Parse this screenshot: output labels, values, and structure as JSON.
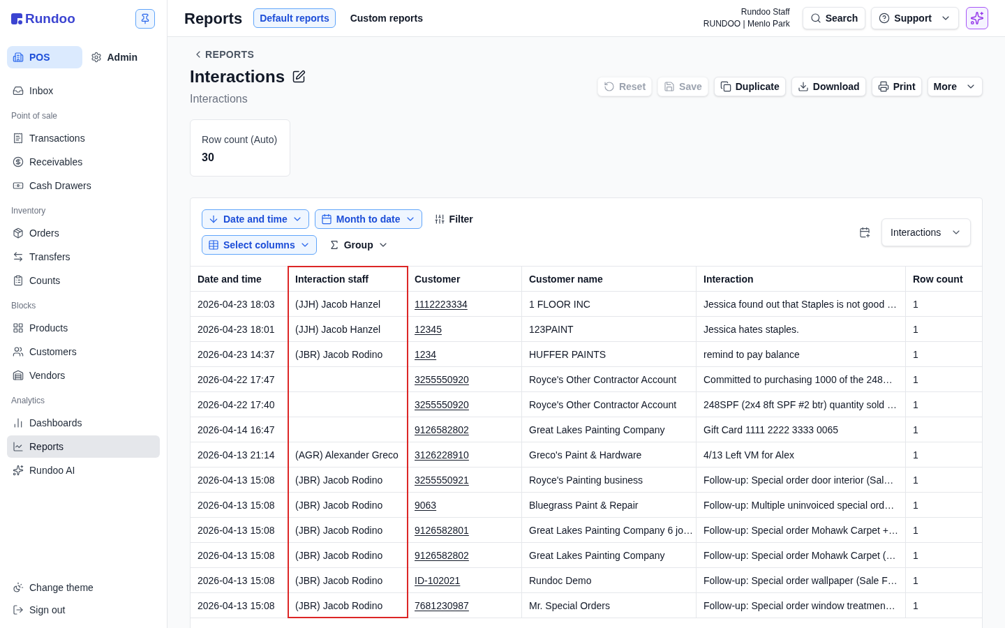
{
  "sidebar": {
    "logo": "Rundoo",
    "modes": [
      {
        "label": "POS",
        "selected": true
      },
      {
        "label": "Admin",
        "selected": false
      }
    ],
    "top_items": [
      {
        "label": "Inbox",
        "selected": false
      }
    ],
    "sections": [
      {
        "title": "Point of sale",
        "items": [
          {
            "label": "Transactions",
            "selected": false
          },
          {
            "label": "Receivables",
            "selected": false
          },
          {
            "label": "Cash Drawers",
            "selected": false
          }
        ]
      },
      {
        "title": "Inventory",
        "items": [
          {
            "label": "Orders",
            "selected": false
          },
          {
            "label": "Transfers",
            "selected": false
          },
          {
            "label": "Counts",
            "selected": false
          }
        ]
      },
      {
        "title": "Blocks",
        "items": [
          {
            "label": "Products",
            "selected": false
          },
          {
            "label": "Customers",
            "selected": false
          },
          {
            "label": "Vendors",
            "selected": false
          }
        ]
      },
      {
        "title": "Analytics",
        "items": [
          {
            "label": "Dashboards",
            "selected": false
          },
          {
            "label": "Reports",
            "selected": true
          },
          {
            "label": "Rundoo AI",
            "selected": false
          }
        ]
      }
    ],
    "footer_items": [
      {
        "label": "Change theme"
      },
      {
        "label": "Sign out"
      }
    ]
  },
  "header": {
    "title": "Reports",
    "tabs": [
      {
        "label": "Default reports",
        "selected": true
      },
      {
        "label": "Custom reports",
        "selected": false
      }
    ],
    "user": {
      "name": "Rundoo Staff",
      "store": "RUNDOO | Menlo Park"
    },
    "search": {
      "label": "Search"
    },
    "support": {
      "label": "Support"
    }
  },
  "report": {
    "back_link": "REPORTS",
    "title": "Interactions",
    "subtitle": "Interactions",
    "actions": [
      {
        "kind": "reset",
        "label": "Reset",
        "disabled": true
      },
      {
        "kind": "save",
        "label": "Save",
        "disabled": true
      },
      {
        "kind": "duplicate",
        "label": "Duplicate",
        "disabled": false
      },
      {
        "kind": "download",
        "label": "Download",
        "disabled": false
      },
      {
        "kind": "print",
        "label": "Print",
        "disabled": false
      },
      {
        "kind": "more",
        "label": "More",
        "disabled": false
      }
    ],
    "summary_cards": [
      {
        "label": "Row count (Auto)",
        "value": "30"
      }
    ]
  },
  "toolbar": {
    "rows": [
      [
        {
          "kind": "sort",
          "label": "Date and time",
          "active": true
        },
        {
          "kind": "date_range",
          "label": "Month to date",
          "active": true
        },
        {
          "kind": "filter",
          "label": "Filter",
          "active": false
        }
      ],
      [
        {
          "kind": "columns",
          "label": "Select columns",
          "active": true
        },
        {
          "kind": "group",
          "label": "Group",
          "active": false
        }
      ]
    ],
    "view_select": {
      "value": "Interactions"
    }
  },
  "table": {
    "columns": [
      {
        "label": "Date and time",
        "kind": "text",
        "highlighted": false
      },
      {
        "label": "Interaction staff",
        "kind": "text",
        "highlighted": true
      },
      {
        "label": "Customer",
        "kind": "link",
        "highlighted": false
      },
      {
        "label": "Customer name",
        "kind": "text",
        "highlighted": false
      },
      {
        "label": "Interaction",
        "kind": "text",
        "highlighted": false
      },
      {
        "label": "Row count",
        "kind": "text",
        "highlighted": false
      }
    ],
    "rows": [
      {
        "cells": [
          "2026-04-23 18:03",
          "(JJH) Jacob Hanzel",
          "1112223334",
          "1 FLOOR INC",
          "Jessica found out that Staples is not good …",
          "1"
        ]
      },
      {
        "cells": [
          "2026-04-23 18:01",
          "(JJH) Jacob Hanzel",
          "12345",
          "123PAINT",
          "Jessica hates staples.",
          "1"
        ]
      },
      {
        "cells": [
          "2026-04-23 14:37",
          "(JBR) Jacob Rodino",
          "1234",
          "HUFFER PAINTS",
          "remind to pay balance",
          "1"
        ]
      },
      {
        "cells": [
          "2026-04-22 17:47",
          null,
          "3255550920",
          "Royce's Other Contractor Account",
          "Committed to purchasing 1000 of the 248…",
          "1"
        ]
      },
      {
        "cells": [
          "2026-04-22 17:40",
          null,
          "3255550920",
          "Royce's Other Contractor Account",
          "248SPF (2x4 8ft SPF #2 btr) quantity sold …",
          "1"
        ]
      },
      {
        "cells": [
          "2026-04-14 16:47",
          null,
          "9126582802",
          "Great Lakes Painting Company",
          "Gift Card 1111 2222 3333 0065",
          "1"
        ]
      },
      {
        "cells": [
          "2026-04-13 21:14",
          "(AGR) Alexander Greco",
          "3126228910",
          "Greco's Paint & Hardware",
          "4/13 Left VM for Alex",
          "1"
        ]
      },
      {
        "cells": [
          "2026-04-13 15:08",
          "(JBR) Jacob Rodino",
          "3255550921",
          "Royce's Painting business",
          "Follow-up: Special order door interior (Sal…",
          "1"
        ]
      },
      {
        "cells": [
          "2026-04-13 15:08",
          "(JBR) Jacob Rodino",
          "9063",
          "Bluegrass Paint & Repair",
          "Follow-up: Multiple uninvoiced special ord…",
          "1"
        ]
      },
      {
        "cells": [
          "2026-04-13 15:08",
          "(JBR) Jacob Rodino",
          "9126582801",
          "Great Lakes Painting Company 6 jo…",
          "Follow-up: Special order Mohawk Carpet +…",
          "1"
        ]
      },
      {
        "cells": [
          "2026-04-13 15:08",
          "(JBR) Jacob Rodino",
          "9126582802",
          "Great Lakes Painting Company",
          "Follow-up: Special order Mohawk Carpet (…",
          "1"
        ]
      },
      {
        "cells": [
          "2026-04-13 15:08",
          "(JBR) Jacob Rodino",
          "ID-102021",
          "Rundoc Demo",
          "Follow-up: Special order wallpaper (Sale F…",
          "1"
        ]
      },
      {
        "cells": [
          "2026-04-13 15:08",
          "(JBR) Jacob Rodino",
          "7681230987",
          "Mr. Special Orders",
          "Follow-up: Special order window treatmen…",
          "1"
        ]
      }
    ]
  }
}
